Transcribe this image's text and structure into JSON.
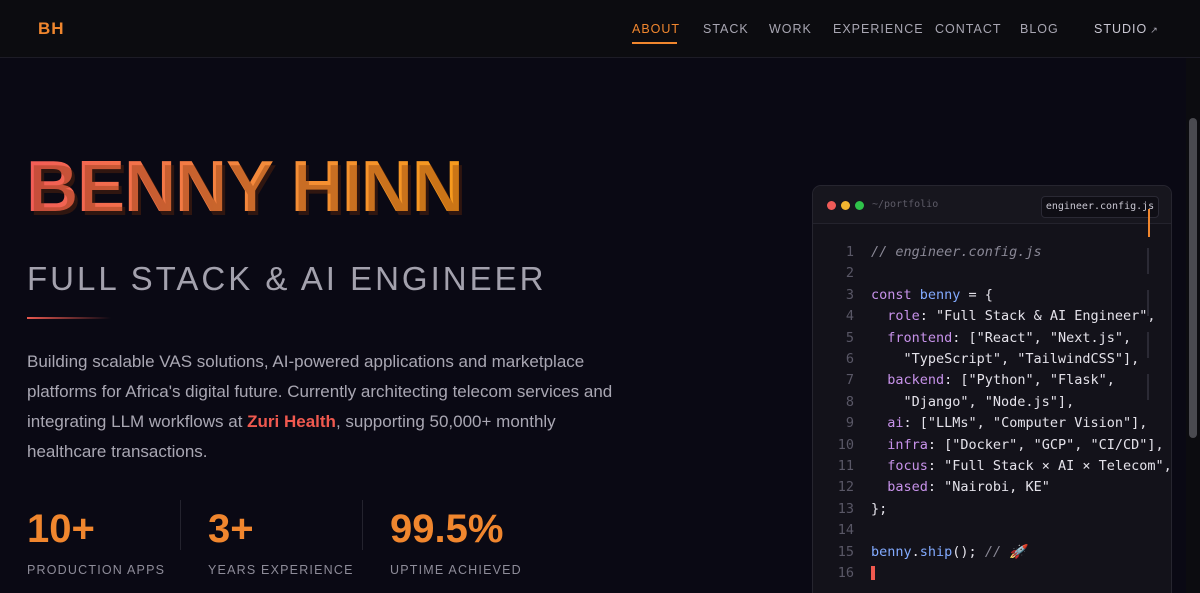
{
  "nav": {
    "logo": "BH",
    "links": [
      "ABOUT",
      "STACK",
      "WORK",
      "EXPERIENCE",
      "CONTACT",
      "BLOG"
    ],
    "active": "ABOUT",
    "studio_label": "STUDIO",
    "studio_icon": "external-link-icon",
    "accent_color": "#f0862e"
  },
  "hero": {
    "name": "BENNY HINN",
    "role": "FULL STACK & AI ENGINEER",
    "desc_1": "Building scalable VAS solutions, AI-powered applications and marketplace platforms for Africa's digital future. Currently architecting telecom services and integrating LLM workflows at ",
    "desc_highlight": "Zuri Health",
    "desc_2": ", supporting 50,000+ monthly healthcare transactions."
  },
  "stats": [
    {
      "value": "10+",
      "label": "PRODUCTION APPS"
    },
    {
      "value": "3+",
      "label": "YEARS EXPERIENCE"
    },
    {
      "value": "99.5%",
      "label": "UPTIME ACHIEVED"
    }
  ],
  "code": {
    "path": "~/portfolio",
    "tab": "engineer.config.js",
    "lines": [
      {
        "n": "1",
        "parts": [
          [
            "com",
            "// engineer.config.js"
          ]
        ]
      },
      {
        "n": "2",
        "parts": []
      },
      {
        "n": "3",
        "parts": [
          [
            "kw",
            "const "
          ],
          [
            "var",
            "benny"
          ],
          [
            "str",
            " = {"
          ]
        ]
      },
      {
        "n": "4",
        "parts": [
          [
            "str",
            "  "
          ],
          [
            "prop",
            "role"
          ],
          [
            "str",
            ": \"Full Stack & AI Engineer\","
          ]
        ]
      },
      {
        "n": "5",
        "parts": [
          [
            "str",
            "  "
          ],
          [
            "prop",
            "frontend"
          ],
          [
            "str",
            ": [\"React\", \"Next.js\","
          ]
        ]
      },
      {
        "n": "6",
        "parts": [
          [
            "str",
            "    \"TypeScript\", \"TailwindCSS\"],"
          ]
        ]
      },
      {
        "n": "7",
        "parts": [
          [
            "str",
            "  "
          ],
          [
            "prop",
            "backend"
          ],
          [
            "str",
            ": [\"Python\", \"Flask\","
          ]
        ]
      },
      {
        "n": "8",
        "parts": [
          [
            "str",
            "    \"Django\", \"Node.js\"],"
          ]
        ]
      },
      {
        "n": "9",
        "parts": [
          [
            "str",
            "  "
          ],
          [
            "prop",
            "ai"
          ],
          [
            "str",
            ": [\"LLMs\", \"Computer Vision\"],"
          ]
        ]
      },
      {
        "n": "10",
        "parts": [
          [
            "str",
            "  "
          ],
          [
            "prop",
            "infra"
          ],
          [
            "str",
            ": [\"Docker\", \"GCP\", \"CI/CD\"],"
          ]
        ]
      },
      {
        "n": "11",
        "parts": [
          [
            "str",
            "  "
          ],
          [
            "prop",
            "focus"
          ],
          [
            "str",
            ": \"Full Stack × AI × Telecom\","
          ]
        ]
      },
      {
        "n": "12",
        "parts": [
          [
            "str",
            "  "
          ],
          [
            "prop",
            "based"
          ],
          [
            "str",
            ": \"Nairobi, KE\""
          ]
        ]
      },
      {
        "n": "13",
        "parts": [
          [
            "str",
            "};"
          ]
        ]
      },
      {
        "n": "14",
        "parts": []
      },
      {
        "n": "15",
        "parts": [
          [
            "var",
            "benny"
          ],
          [
            "str",
            "."
          ],
          [
            "fn",
            "ship"
          ],
          [
            "str",
            "(); "
          ],
          [
            "com",
            "// 🚀"
          ]
        ]
      },
      {
        "n": "16",
        "parts": [
          [
            "cursor",
            ""
          ]
        ]
      }
    ]
  }
}
